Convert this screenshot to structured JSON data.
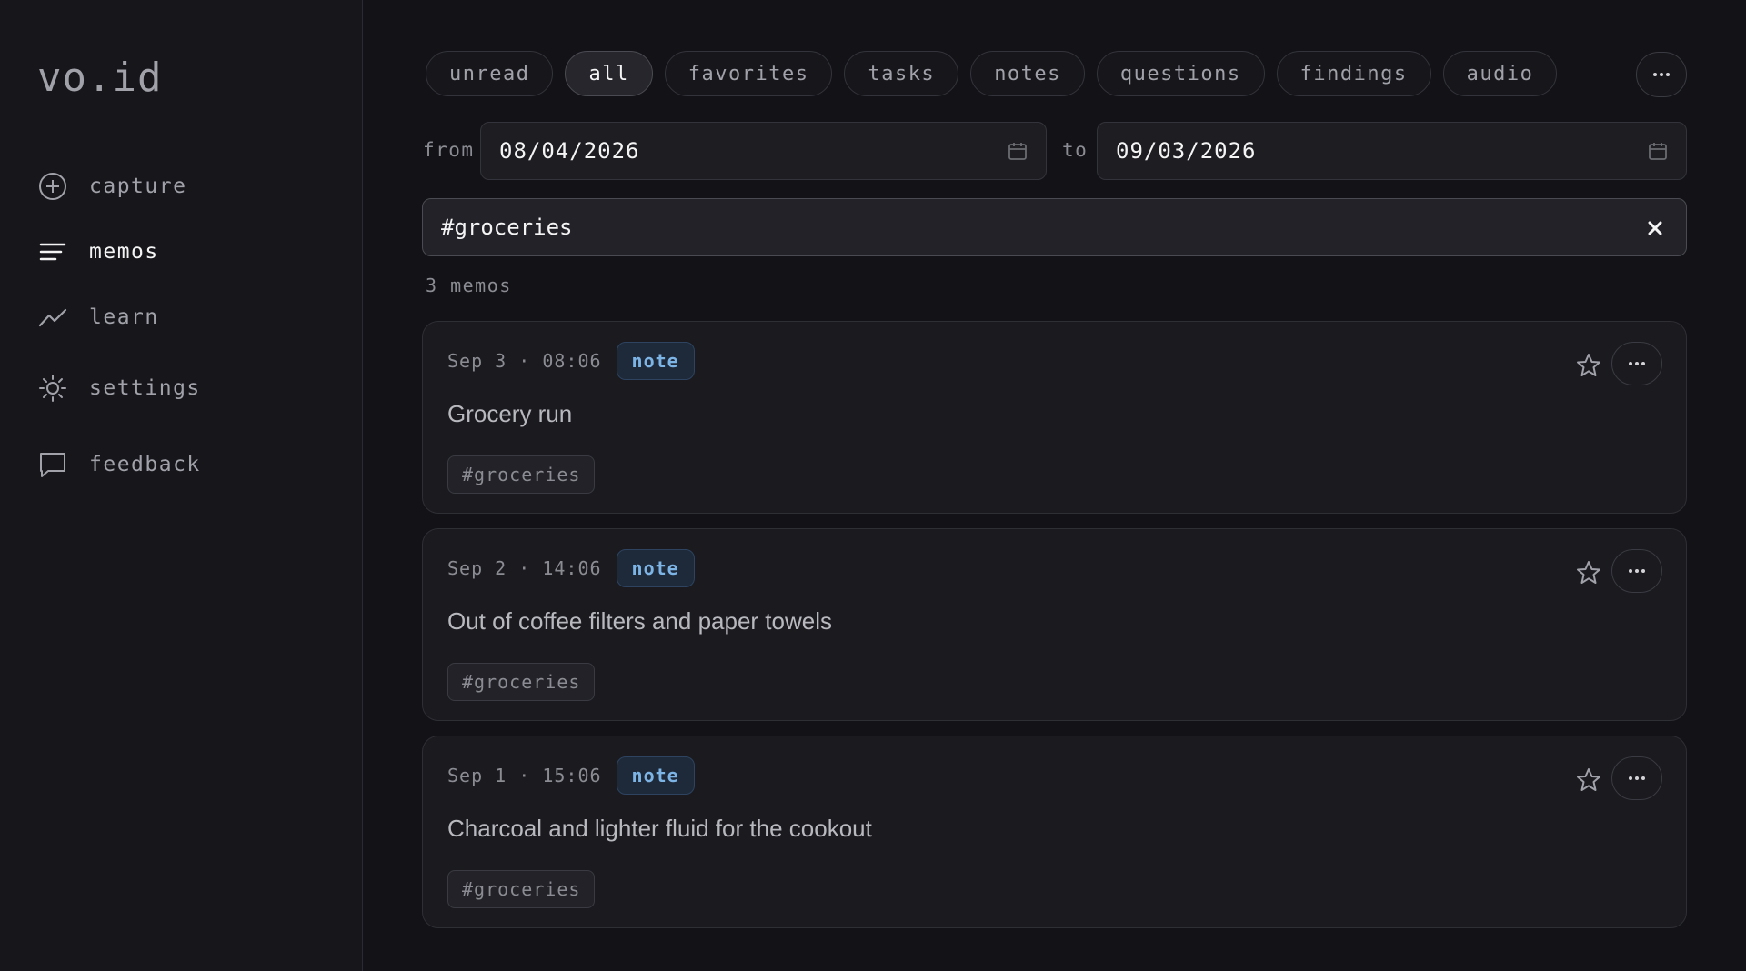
{
  "app": {
    "logo": "vo.id"
  },
  "sidebar": {
    "items": [
      {
        "label": "capture",
        "icon": "plus-circle-icon"
      },
      {
        "label": "memos",
        "icon": "lines-icon",
        "active": true
      },
      {
        "label": "learn",
        "icon": "trend-icon"
      },
      {
        "label": "settings",
        "icon": "sun-icon"
      },
      {
        "label": "feedback",
        "icon": "chat-icon"
      }
    ]
  },
  "filters": {
    "tabs": [
      {
        "label": "unread"
      },
      {
        "label": "all",
        "active": true
      },
      {
        "label": "favorites"
      },
      {
        "label": "tasks"
      },
      {
        "label": "notes"
      },
      {
        "label": "questions"
      },
      {
        "label": "findings"
      },
      {
        "label": "audio"
      }
    ],
    "more_icon": "ellipsis-icon"
  },
  "date_range": {
    "from_label": "from",
    "from_value": "08/04/2026",
    "to_label": "to",
    "to_value": "09/03/2026"
  },
  "search": {
    "query": "#groceries"
  },
  "results": {
    "count_text": "3 memos",
    "memos": [
      {
        "timestamp": "Sep 3 · 08:06",
        "type": "note",
        "title": "Grocery run",
        "tag": "#groceries"
      },
      {
        "timestamp": "Sep 2 · 14:06",
        "type": "note",
        "title": "Out of coffee filters and paper towels",
        "tag": "#groceries"
      },
      {
        "timestamp": "Sep 1 · 15:06",
        "type": "note",
        "title": "Charcoal and lighter fluid for the cookout",
        "tag": "#groceries"
      }
    ]
  },
  "colors": {
    "background": "#121217",
    "badge_text": "#7db4e6"
  }
}
